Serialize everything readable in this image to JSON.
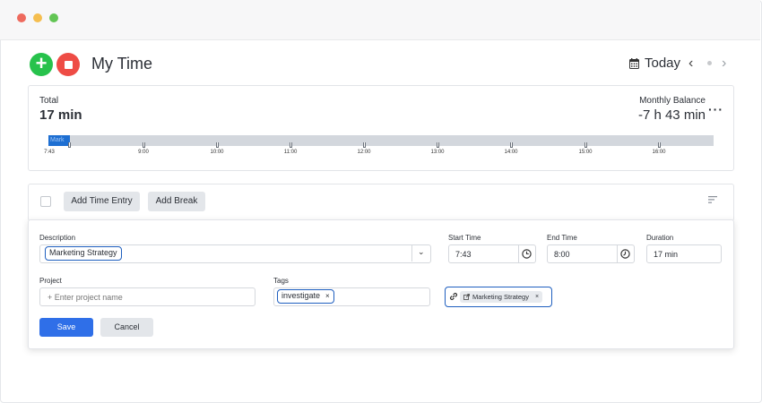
{
  "header": {
    "title": "My Time",
    "today_label": "Today"
  },
  "summary": {
    "total_label": "Total",
    "total_value": "17 min",
    "balance_label": "Monthly Balance",
    "balance_value": "-7 h 43 min",
    "more_label": "···"
  },
  "timeline": {
    "segment_label": "Mark",
    "ticks": [
      "7:43",
      "9:00",
      "10:00",
      "11:00",
      "12:00",
      "13:00",
      "14:00",
      "15:00",
      "16:00"
    ]
  },
  "toolbar": {
    "add_entry_label": "Add Time Entry",
    "add_break_label": "Add Break"
  },
  "form": {
    "description_label": "Description",
    "description_value": "Marketing Strategy",
    "start_label": "Start Time",
    "start_value": "7:43",
    "end_label": "End Time",
    "end_value": "8:00",
    "duration_label": "Duration",
    "duration_value": "17 min",
    "project_label": "Project",
    "project_placeholder": "+ Enter project name",
    "tags_label": "Tags",
    "tag_value": "investigate",
    "linked_item": "Marketing Strategy",
    "save_label": "Save",
    "cancel_label": "Cancel"
  },
  "colors": {
    "accent": "#2f6fe8",
    "add": "#27c24c",
    "stop": "#ee4c45",
    "timeline_fill": "#1e6fd2"
  }
}
